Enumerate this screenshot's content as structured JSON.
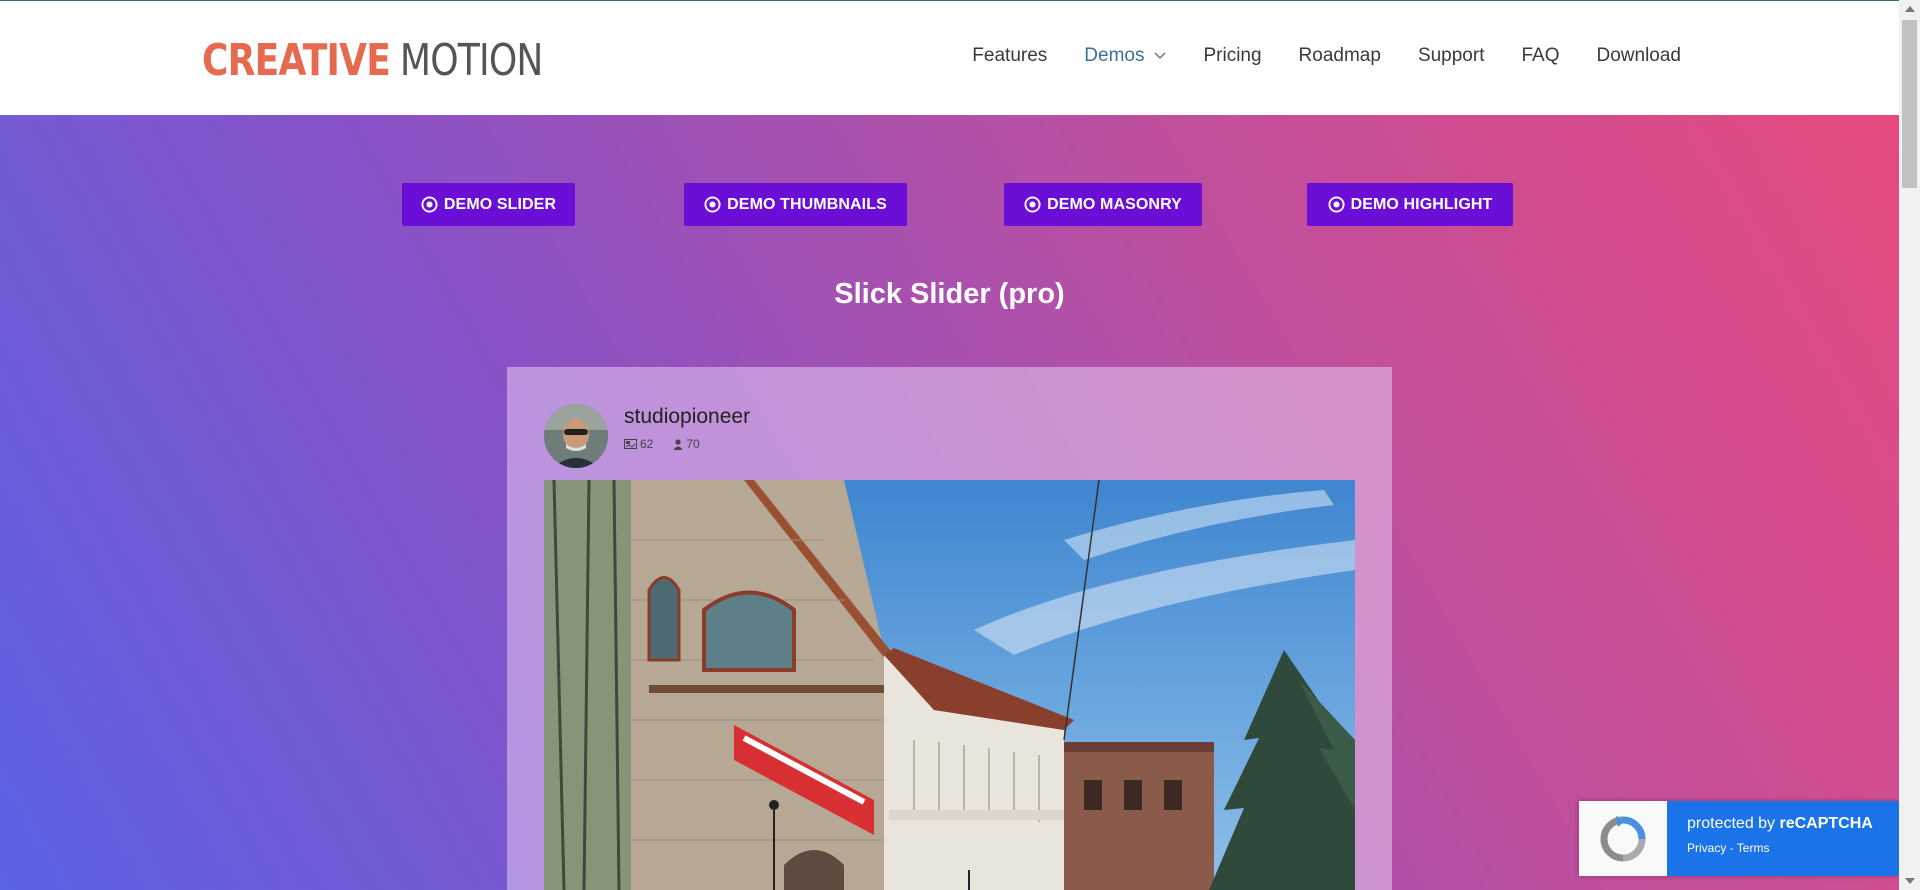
{
  "brand": {
    "part1": "CREATIVE",
    "part2": "MOTION",
    "accent": "#e56a4f"
  },
  "nav": {
    "items": [
      {
        "label": "Features"
      },
      {
        "label": "Demos",
        "has_dropdown": true,
        "active": true
      },
      {
        "label": "Pricing"
      },
      {
        "label": "Roadmap"
      },
      {
        "label": "Support"
      },
      {
        "label": "FAQ"
      },
      {
        "label": "Download"
      }
    ]
  },
  "demo_buttons": [
    {
      "label": "DEMO SLIDER",
      "icon": "target-icon"
    },
    {
      "label": "DEMO THUMBNAILS",
      "icon": "target-icon"
    },
    {
      "label": "DEMO MASONRY",
      "icon": "target-icon"
    },
    {
      "label": "DEMO HIGHLIGHT",
      "icon": "target-icon"
    }
  ],
  "button_color": "#6c0fd6",
  "section_title": "Slick Slider (pro)",
  "profile": {
    "username": "studiopioneer",
    "posts_count": "62",
    "followers_count": "70",
    "posts_icon": "image-icon",
    "followers_icon": "user-icon"
  },
  "recaptcha": {
    "line1_prefix": "protected by ",
    "line1_brand": "reCAPTCHA",
    "privacy": "Privacy",
    "separator": " - ",
    "terms": "Terms"
  }
}
